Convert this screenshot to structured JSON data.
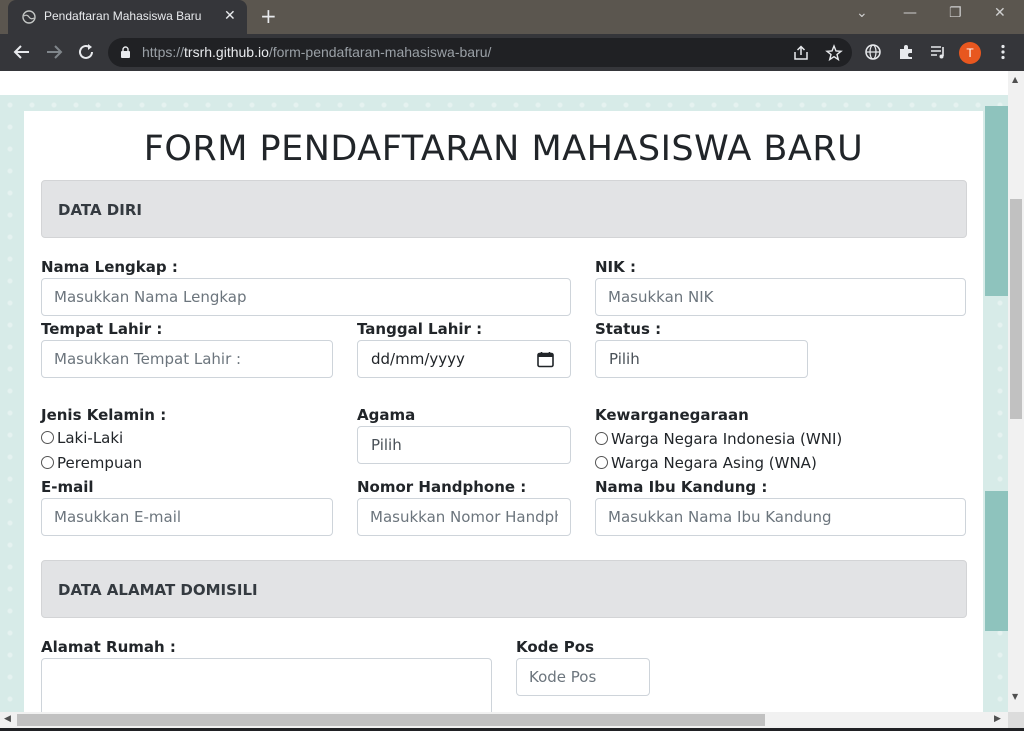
{
  "browser": {
    "tab_title": "Pendaftaran Mahasiswa Baru",
    "url_scheme": "https://",
    "url_host": "trsrh.github.io",
    "url_path": "/form-pendaftaran-mahasiswa-baru/",
    "profile_initial": "T"
  },
  "form": {
    "title": "FORM PENDAFTARAN MAHASISWA BARU",
    "section_personal": "DATA DIRI",
    "section_address": "DATA ALAMAT DOMISILI",
    "fields": {
      "nama_label": "Nama Lengkap :",
      "nama_placeholder": "Masukkan Nama Lengkap",
      "nik_label": "NIK :",
      "nik_placeholder": "Masukkan NIK",
      "tempat_label": "Tempat Lahir :",
      "tempat_placeholder": "Masukkan Tempat Lahir :",
      "tanggal_label": "Tanggal Lahir :",
      "tanggal_value": "dd/mm/yyyy",
      "status_label": "Status :",
      "status_value": "Pilih",
      "gender_label": "Jenis Kelamin :",
      "gender_options": [
        "Laki-Laki",
        "Perempuan"
      ],
      "agama_label": "Agama",
      "agama_value": "Pilih",
      "kewarganegaraan_label": "Kewarganegaraan",
      "kewarganegaraan_options": [
        "Warga Negara Indonesia (WNI)",
        "Warga Negara Asing (WNA)"
      ],
      "email_label": "E-mail",
      "email_placeholder": "Masukkan E-mail",
      "hp_label": "Nomor Handphone :",
      "hp_placeholder": "Masukkan Nomor Handphone",
      "ibu_label": "Nama Ibu Kandung :",
      "ibu_placeholder": "Masukkan Nama Ibu Kandung",
      "alamat_label": "Alamat Rumah :",
      "kodepos_label": "Kode Pos",
      "kodepos_placeholder": "Kode Pos"
    }
  },
  "icons": {
    "favicon": "globe-icon",
    "close": "close-icon",
    "new_tab": "plus-icon",
    "back": "arrow-left-icon",
    "forward": "arrow-right-icon",
    "reload": "reload-icon",
    "lock": "lock-icon",
    "share": "share-icon",
    "bookmark": "star-icon",
    "extensions": "puzzle-icon",
    "calendar": "calendar-icon"
  }
}
